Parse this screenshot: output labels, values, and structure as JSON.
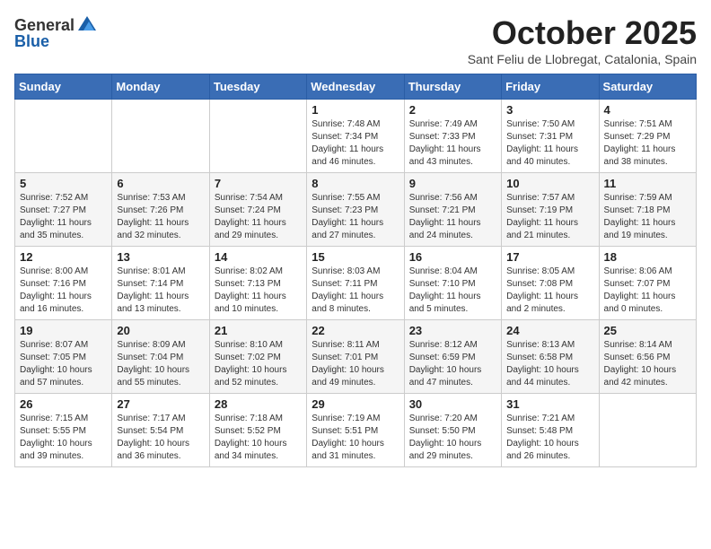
{
  "header": {
    "logo_general": "General",
    "logo_blue": "Blue",
    "month_title": "October 2025",
    "subtitle": "Sant Feliu de Llobregat, Catalonia, Spain"
  },
  "days_of_week": [
    "Sunday",
    "Monday",
    "Tuesday",
    "Wednesday",
    "Thursday",
    "Friday",
    "Saturday"
  ],
  "weeks": [
    [
      {
        "day": "",
        "info": ""
      },
      {
        "day": "",
        "info": ""
      },
      {
        "day": "",
        "info": ""
      },
      {
        "day": "1",
        "info": "Sunrise: 7:48 AM\nSunset: 7:34 PM\nDaylight: 11 hours and 46 minutes."
      },
      {
        "day": "2",
        "info": "Sunrise: 7:49 AM\nSunset: 7:33 PM\nDaylight: 11 hours and 43 minutes."
      },
      {
        "day": "3",
        "info": "Sunrise: 7:50 AM\nSunset: 7:31 PM\nDaylight: 11 hours and 40 minutes."
      },
      {
        "day": "4",
        "info": "Sunrise: 7:51 AM\nSunset: 7:29 PM\nDaylight: 11 hours and 38 minutes."
      }
    ],
    [
      {
        "day": "5",
        "info": "Sunrise: 7:52 AM\nSunset: 7:27 PM\nDaylight: 11 hours and 35 minutes."
      },
      {
        "day": "6",
        "info": "Sunrise: 7:53 AM\nSunset: 7:26 PM\nDaylight: 11 hours and 32 minutes."
      },
      {
        "day": "7",
        "info": "Sunrise: 7:54 AM\nSunset: 7:24 PM\nDaylight: 11 hours and 29 minutes."
      },
      {
        "day": "8",
        "info": "Sunrise: 7:55 AM\nSunset: 7:23 PM\nDaylight: 11 hours and 27 minutes."
      },
      {
        "day": "9",
        "info": "Sunrise: 7:56 AM\nSunset: 7:21 PM\nDaylight: 11 hours and 24 minutes."
      },
      {
        "day": "10",
        "info": "Sunrise: 7:57 AM\nSunset: 7:19 PM\nDaylight: 11 hours and 21 minutes."
      },
      {
        "day": "11",
        "info": "Sunrise: 7:59 AM\nSunset: 7:18 PM\nDaylight: 11 hours and 19 minutes."
      }
    ],
    [
      {
        "day": "12",
        "info": "Sunrise: 8:00 AM\nSunset: 7:16 PM\nDaylight: 11 hours and 16 minutes."
      },
      {
        "day": "13",
        "info": "Sunrise: 8:01 AM\nSunset: 7:14 PM\nDaylight: 11 hours and 13 minutes."
      },
      {
        "day": "14",
        "info": "Sunrise: 8:02 AM\nSunset: 7:13 PM\nDaylight: 11 hours and 10 minutes."
      },
      {
        "day": "15",
        "info": "Sunrise: 8:03 AM\nSunset: 7:11 PM\nDaylight: 11 hours and 8 minutes."
      },
      {
        "day": "16",
        "info": "Sunrise: 8:04 AM\nSunset: 7:10 PM\nDaylight: 11 hours and 5 minutes."
      },
      {
        "day": "17",
        "info": "Sunrise: 8:05 AM\nSunset: 7:08 PM\nDaylight: 11 hours and 2 minutes."
      },
      {
        "day": "18",
        "info": "Sunrise: 8:06 AM\nSunset: 7:07 PM\nDaylight: 11 hours and 0 minutes."
      }
    ],
    [
      {
        "day": "19",
        "info": "Sunrise: 8:07 AM\nSunset: 7:05 PM\nDaylight: 10 hours and 57 minutes."
      },
      {
        "day": "20",
        "info": "Sunrise: 8:09 AM\nSunset: 7:04 PM\nDaylight: 10 hours and 55 minutes."
      },
      {
        "day": "21",
        "info": "Sunrise: 8:10 AM\nSunset: 7:02 PM\nDaylight: 10 hours and 52 minutes."
      },
      {
        "day": "22",
        "info": "Sunrise: 8:11 AM\nSunset: 7:01 PM\nDaylight: 10 hours and 49 minutes."
      },
      {
        "day": "23",
        "info": "Sunrise: 8:12 AM\nSunset: 6:59 PM\nDaylight: 10 hours and 47 minutes."
      },
      {
        "day": "24",
        "info": "Sunrise: 8:13 AM\nSunset: 6:58 PM\nDaylight: 10 hours and 44 minutes."
      },
      {
        "day": "25",
        "info": "Sunrise: 8:14 AM\nSunset: 6:56 PM\nDaylight: 10 hours and 42 minutes."
      }
    ],
    [
      {
        "day": "26",
        "info": "Sunrise: 7:15 AM\nSunset: 5:55 PM\nDaylight: 10 hours and 39 minutes."
      },
      {
        "day": "27",
        "info": "Sunrise: 7:17 AM\nSunset: 5:54 PM\nDaylight: 10 hours and 36 minutes."
      },
      {
        "day": "28",
        "info": "Sunrise: 7:18 AM\nSunset: 5:52 PM\nDaylight: 10 hours and 34 minutes."
      },
      {
        "day": "29",
        "info": "Sunrise: 7:19 AM\nSunset: 5:51 PM\nDaylight: 10 hours and 31 minutes."
      },
      {
        "day": "30",
        "info": "Sunrise: 7:20 AM\nSunset: 5:50 PM\nDaylight: 10 hours and 29 minutes."
      },
      {
        "day": "31",
        "info": "Sunrise: 7:21 AM\nSunset: 5:48 PM\nDaylight: 10 hours and 26 minutes."
      },
      {
        "day": "",
        "info": ""
      }
    ]
  ]
}
